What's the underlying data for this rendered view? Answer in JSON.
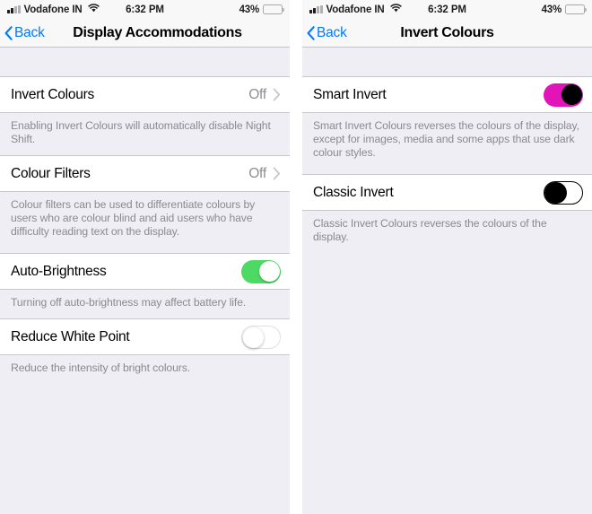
{
  "status_bar": {
    "carrier": "Vodafone IN",
    "time": "6:32 PM",
    "battery_percent": "43%",
    "battery_level": 43,
    "signal_icon": "signal-bars-icon",
    "wifi_icon": "wifi-icon",
    "battery_icon": "battery-icon"
  },
  "colors": {
    "accent_blue": "#007aff",
    "toggle_on_green": "#4cd964",
    "toggle_on_magenta": "#e313ba",
    "toggle_off_black": "#000000",
    "group_background": "#efeef4",
    "cell_background": "#ffffff",
    "footer_text": "#8a8a8e",
    "value_text": "#8e8e93",
    "navbar_background": "#f8f8f8"
  },
  "left_screen": {
    "nav": {
      "back_label": "Back",
      "back_icon": "chevron-left-icon",
      "title": "Display Accommodations"
    },
    "rows": [
      {
        "label": "Invert Colours",
        "value": "Off",
        "accessory": "chevron-right-icon",
        "type": "disclosure",
        "footer": "Enabling Invert Colours will automatically disable Night Shift."
      },
      {
        "label": "Colour Filters",
        "value": "Off",
        "accessory": "chevron-right-icon",
        "type": "disclosure",
        "footer": "Colour filters can be used to differentiate colours by users who are colour blind and aid users who have difficulty reading text on the display."
      },
      {
        "label": "Auto-Brightness",
        "type": "switch",
        "switch_state": "on",
        "switch_style": "green",
        "footer": "Turning off auto-brightness may affect battery life."
      },
      {
        "label": "Reduce White Point",
        "type": "switch",
        "switch_state": "off",
        "switch_style": "plain",
        "footer": "Reduce the intensity of bright colours."
      }
    ]
  },
  "right_screen": {
    "nav": {
      "back_label": "Back",
      "back_icon": "chevron-left-icon",
      "title": "Invert Colours"
    },
    "rows": [
      {
        "label": "Smart Invert",
        "type": "switch",
        "switch_state": "on",
        "switch_style": "magenta",
        "footer": "Smart Invert Colours reverses the colours of the display, except for images, media and some apps that use dark colour styles."
      },
      {
        "label": "Classic Invert",
        "type": "switch",
        "switch_state": "off",
        "switch_style": "black",
        "footer": "Classic Invert Colours reverses the colours of the display."
      }
    ]
  }
}
